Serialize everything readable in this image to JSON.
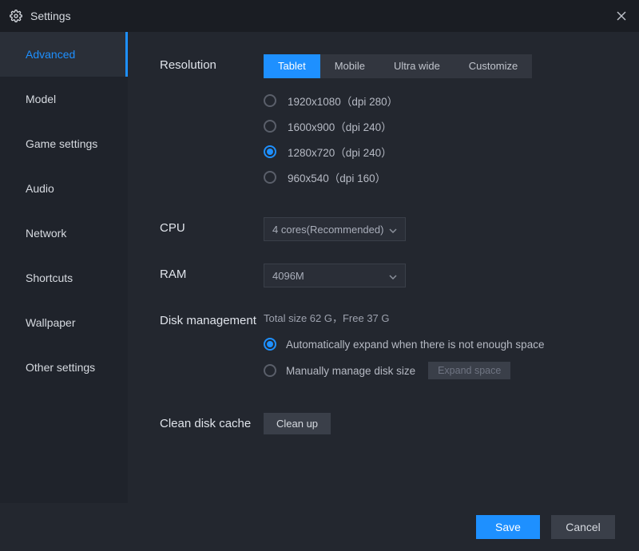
{
  "window": {
    "title": "Settings"
  },
  "sidebar": {
    "items": [
      "Advanced",
      "Model",
      "Game settings",
      "Audio",
      "Network",
      "Shortcuts",
      "Wallpaper",
      "Other settings"
    ],
    "selected_index": 0
  },
  "resolution": {
    "label": "Resolution",
    "tabs": [
      "Tablet",
      "Mobile",
      "Ultra wide",
      "Customize"
    ],
    "active_tab_index": 0,
    "options": [
      "1920x1080（dpi 280）",
      "1600x900（dpi 240）",
      "1280x720（dpi 240）",
      "960x540（dpi 160）"
    ],
    "selected_option_index": 2
  },
  "cpu": {
    "label": "CPU",
    "value": "4 cores(Recommended)"
  },
  "ram": {
    "label": "RAM",
    "value": "4096M"
  },
  "disk": {
    "label": "Disk management",
    "info": "Total size 62 G，Free 37 G",
    "auto_label": "Automatically expand when there is not enough space",
    "manual_label": "Manually manage disk size",
    "expand_button": "Expand space",
    "mode_selected": "auto"
  },
  "clean": {
    "label": "Clean disk cache",
    "button": "Clean up"
  },
  "footer": {
    "save": "Save",
    "cancel": "Cancel"
  }
}
